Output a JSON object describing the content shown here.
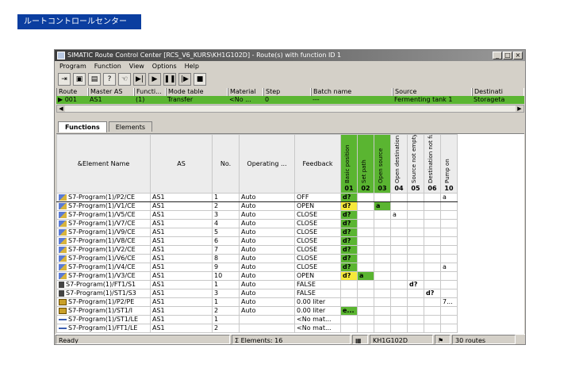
{
  "banner": "ルートコントロールセンター",
  "window": {
    "title": "SIMATIC Route Control Center [RCS_V6_KURS\\KH1G102D] - Route(s) with function ID 1",
    "buttons": [
      "_",
      "□",
      "×"
    ]
  },
  "menu": [
    "Program",
    "Function",
    "View",
    "Options",
    "Help"
  ],
  "route_header": [
    "Route",
    "Master AS",
    "Functi...",
    "Mode table",
    "Material",
    "Step",
    "Batch name",
    "Source",
    "Destinati"
  ],
  "route_row": [
    "001",
    "AS1",
    "(1)",
    "Transfer",
    "<No ...",
    "0",
    "---",
    "Fermenting tank 1",
    "Storageta"
  ],
  "tabs": {
    "functions": "Functions",
    "elements": "Elements"
  },
  "columns": {
    "element_name": "&Element Name",
    "as": "AS",
    "no": "No.",
    "operating": "Operating ...",
    "feedback": "Feedback",
    "funcs": [
      {
        "label": "Basic position",
        "num": "01"
      },
      {
        "label": "Set path",
        "num": "02"
      },
      {
        "label": "Open source",
        "num": "03"
      },
      {
        "label": "Open destination",
        "num": "04"
      },
      {
        "label": "Source not empty",
        "num": "05"
      },
      {
        "label": "Destination not full",
        "num": "06"
      },
      {
        "label": "Pump on",
        "num": "10"
      }
    ]
  },
  "rows": [
    {
      "icon": "valve",
      "name": "S7-Program(1)/P2/CE",
      "as": "AS1",
      "no": "1",
      "op": "Auto",
      "fb": "OFF",
      "c": [
        "d?",
        "",
        "",
        "",
        "",
        "",
        "a"
      ],
      "t": [
        "g",
        "",
        "",
        "",
        "",
        "",
        ""
      ],
      "sel": true
    },
    {
      "icon": "valve",
      "name": "S7-Program(1)/V1/CE",
      "as": "AS1",
      "no": "2",
      "op": "Auto",
      "fb": "OPEN",
      "c": [
        "d?",
        "",
        "a",
        "",
        "",
        "",
        ""
      ],
      "t": [
        "y",
        "",
        "g",
        "",
        "",
        "",
        ""
      ]
    },
    {
      "icon": "valve",
      "name": "S7-Program(1)/V5/CE",
      "as": "AS1",
      "no": "3",
      "op": "Auto",
      "fb": "CLOSE",
      "c": [
        "d?",
        "",
        "",
        "a",
        "",
        "",
        ""
      ],
      "t": [
        "g",
        "",
        "",
        "",
        "",
        "",
        ""
      ]
    },
    {
      "icon": "valve",
      "name": "S7-Program(1)/V7/CE",
      "as": "AS1",
      "no": "4",
      "op": "Auto",
      "fb": "CLOSE",
      "c": [
        "d?",
        "",
        "",
        "",
        "",
        "",
        ""
      ],
      "t": [
        "g",
        "",
        "",
        "",
        "",
        "",
        ""
      ]
    },
    {
      "icon": "valve",
      "name": "S7-Program(1)/V9/CE",
      "as": "AS1",
      "no": "5",
      "op": "Auto",
      "fb": "CLOSE",
      "c": [
        "d?",
        "",
        "",
        "",
        "",
        "",
        ""
      ],
      "t": [
        "g",
        "",
        "",
        "",
        "",
        "",
        ""
      ]
    },
    {
      "icon": "valve",
      "name": "S7-Program(1)/V8/CE",
      "as": "AS1",
      "no": "6",
      "op": "Auto",
      "fb": "CLOSE",
      "c": [
        "d?",
        "",
        "",
        "",
        "",
        "",
        ""
      ],
      "t": [
        "g",
        "",
        "",
        "",
        "",
        "",
        ""
      ]
    },
    {
      "icon": "valve",
      "name": "S7-Program(1)/V2/CE",
      "as": "AS1",
      "no": "7",
      "op": "Auto",
      "fb": "CLOSE",
      "c": [
        "d?",
        "",
        "",
        "",
        "",
        "",
        ""
      ],
      "t": [
        "g",
        "",
        "",
        "",
        "",
        "",
        ""
      ]
    },
    {
      "icon": "valve",
      "name": "S7-Program(1)/V6/CE",
      "as": "AS1",
      "no": "8",
      "op": "Auto",
      "fb": "CLOSE",
      "c": [
        "d?",
        "",
        "",
        "",
        "",
        "",
        ""
      ],
      "t": [
        "g",
        "",
        "",
        "",
        "",
        "",
        ""
      ]
    },
    {
      "icon": "valve",
      "name": "S7-Program(1)/V4/CE",
      "as": "AS1",
      "no": "9",
      "op": "Auto",
      "fb": "CLOSE",
      "c": [
        "d?",
        "",
        "",
        "",
        "",
        "",
        "a"
      ],
      "t": [
        "g",
        "",
        "",
        "",
        "",
        "",
        ""
      ]
    },
    {
      "icon": "valve",
      "name": "S7-Program(1)/V3/CE",
      "as": "AS1",
      "no": "10",
      "op": "Auto",
      "fb": "OPEN",
      "c": [
        "d?",
        "a",
        "",
        "",
        "",
        "",
        ""
      ],
      "t": [
        "y",
        "g",
        "",
        "",
        "",
        "",
        ""
      ]
    },
    {
      "icon": "sensor",
      "name": "S7-Program(1)/FT1/S1",
      "as": "AS1",
      "no": "1",
      "op": "Auto",
      "fb": "FALSE",
      "c": [
        "",
        "",
        "",
        "",
        "d?",
        "",
        ""
      ],
      "t": [
        "",
        "",
        "",
        "",
        "b",
        "",
        ""
      ]
    },
    {
      "icon": "sensor",
      "name": "S7-Program(1)/ST1/S3",
      "as": "AS1",
      "no": "3",
      "op": "Auto",
      "fb": "FALSE",
      "c": [
        "",
        "",
        "",
        "",
        "",
        "d?",
        ""
      ],
      "t": [
        "",
        "",
        "",
        "",
        "",
        "b",
        ""
      ]
    },
    {
      "icon": "pump",
      "name": "S7-Program(1)/P2/PE",
      "as": "AS1",
      "no": "1",
      "op": "Auto",
      "fb": "0.00 liter",
      "c": [
        "",
        "",
        "",
        "",
        "",
        "",
        "7..."
      ],
      "t": [
        "",
        "",
        "",
        "",
        "",
        "",
        ""
      ]
    },
    {
      "icon": "pump",
      "name": "S7-Program(1)/ST1/I",
      "as": "AS1",
      "no": "2",
      "op": "Auto",
      "fb": "0.00 liter",
      "c": [
        "e...",
        "",
        "",
        "",
        "",
        "",
        ""
      ],
      "t": [
        "g",
        "",
        "",
        "",
        "",
        "",
        ""
      ]
    },
    {
      "icon": "line",
      "name": "S7-Program(1)/ST1/LE",
      "as": "AS1",
      "no": "1",
      "op": "",
      "fb": "<No mat...",
      "c": [
        "",
        "",
        "",
        "",
        "",
        "",
        ""
      ],
      "t": [
        "",
        "",
        "",
        "",
        "",
        "",
        ""
      ]
    },
    {
      "icon": "line",
      "name": "S7-Program(1)/FT1/LE",
      "as": "AS1",
      "no": "2",
      "op": "",
      "fb": "<No mat...",
      "c": [
        "",
        "",
        "",
        "",
        "",
        "",
        ""
      ],
      "t": [
        "",
        "",
        "",
        "",
        "",
        "",
        ""
      ]
    }
  ],
  "status": {
    "ready": "Ready",
    "elements": "Σ  Elements: 16",
    "server": "KH1G102D",
    "routes": "30 routes"
  }
}
